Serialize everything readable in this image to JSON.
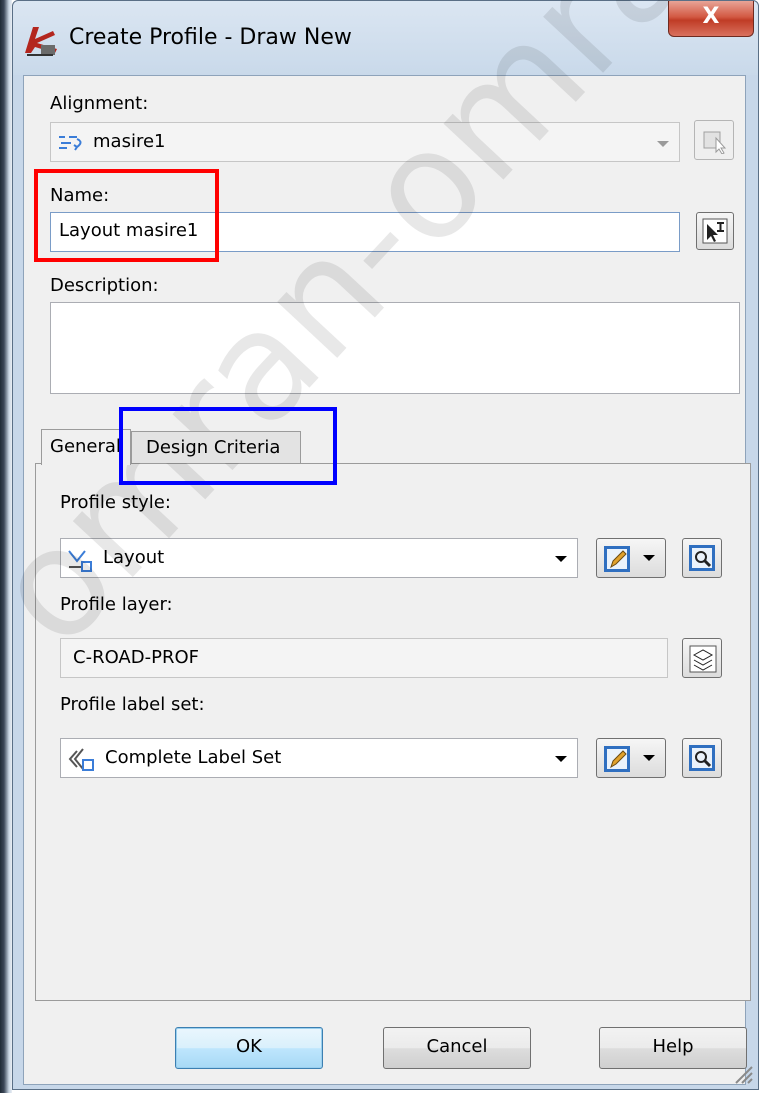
{
  "window": {
    "title": "Create Profile - Draw New",
    "close_glyph": "X"
  },
  "alignment": {
    "label": "Alignment:",
    "value": "masire1"
  },
  "name": {
    "label": "Name:",
    "value": "Layout masire1"
  },
  "description": {
    "label": "Description:",
    "value": ""
  },
  "tabs": [
    {
      "label": "General",
      "active": true
    },
    {
      "label": "Design Criteria",
      "active": false
    }
  ],
  "general": {
    "profile_style": {
      "label": "Profile style:",
      "value": "Layout"
    },
    "profile_layer": {
      "label": "Profile layer:",
      "value": "C-ROAD-PROF"
    },
    "profile_label_set": {
      "label": "Profile label set:",
      "value": "Complete Label Set"
    }
  },
  "buttons": {
    "ok": "OK",
    "cancel": "Cancel",
    "help": "Help"
  },
  "watermark": "omran-omran",
  "colors": {
    "highlight_red": "#ff0000",
    "highlight_blue": "#0000ff",
    "close_button": "#c94a34"
  },
  "icons": [
    "app-icon",
    "alignment-icon",
    "pick-from-drawing-icon",
    "pick-name-icon",
    "profile-style-icon",
    "edit-style-icon",
    "browse-icon",
    "layer-icon",
    "label-set-icon",
    "resize-grip-icon"
  ]
}
